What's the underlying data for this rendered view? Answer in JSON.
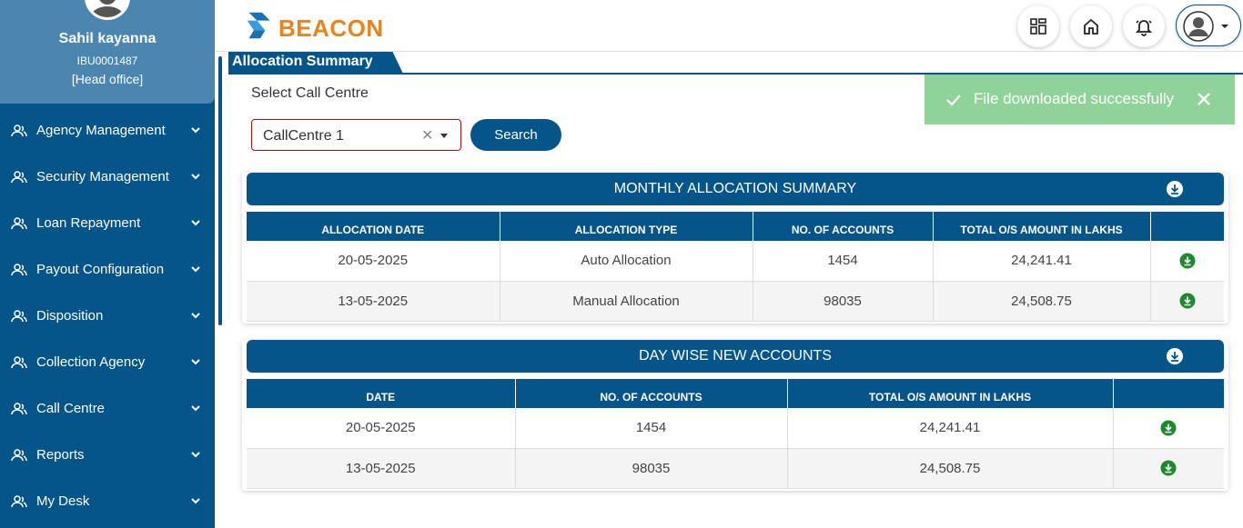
{
  "profile": {
    "name": "Sahil kayanna",
    "id": "IBU0001487",
    "office": "[Head office]"
  },
  "sidebar": {
    "items": [
      {
        "label": "Agency Management",
        "icon": "users-icon"
      },
      {
        "label": "Security Management",
        "icon": "users-icon"
      },
      {
        "label": "Loan Repayment",
        "icon": "users-icon"
      },
      {
        "label": "Payout Configuration",
        "icon": "users-icon"
      },
      {
        "label": "Disposition",
        "icon": "users-icon"
      },
      {
        "label": "Collection Agency",
        "icon": "users-icon"
      },
      {
        "label": "Call Centre",
        "icon": "users-icon"
      },
      {
        "label": "Reports",
        "icon": "users-icon"
      },
      {
        "label": "My Desk",
        "icon": "users-icon"
      }
    ]
  },
  "header": {
    "logo_text": "BEACON",
    "icons": [
      "grid-icon",
      "home-icon",
      "bell-icon",
      "user-avatar-icon"
    ]
  },
  "page": {
    "tab_title": "Allocation Summary",
    "select_label": "Select Call Centre",
    "selected_call_centre": "CallCentre 1",
    "search_label": "Search"
  },
  "toast": {
    "message": "File downloaded successfully"
  },
  "monthly": {
    "title": "MONTHLY ALLOCATION SUMMARY",
    "columns": [
      "ALLOCATION DATE",
      "ALLOCATION TYPE",
      "NO. OF ACCOUNTS",
      "TOTAL O/S AMOUNT IN LAKHS",
      ""
    ],
    "rows": [
      {
        "date": "20-05-2025",
        "type": "Auto Allocation",
        "accounts": "1454",
        "amount": "24,241.41"
      },
      {
        "date": "13-05-2025",
        "type": "Manual Allocation",
        "accounts": "98035",
        "amount": "24,508.75"
      }
    ]
  },
  "daywise": {
    "title": "DAY WISE NEW ACCOUNTS",
    "columns": [
      "DATE",
      "NO. OF ACCOUNTS",
      "TOTAL O/S AMOUNT IN LAKHS",
      ""
    ],
    "rows": [
      {
        "date": "20-05-2025",
        "accounts": "1454",
        "amount": "24,241.41"
      },
      {
        "date": "13-05-2025",
        "accounts": "98035",
        "amount": "24,508.75"
      }
    ]
  },
  "colors": {
    "primary": "#06558a",
    "accent": "#e8841e",
    "toast_bg": "#8fd39a",
    "download_green": "#1e8a2e"
  }
}
